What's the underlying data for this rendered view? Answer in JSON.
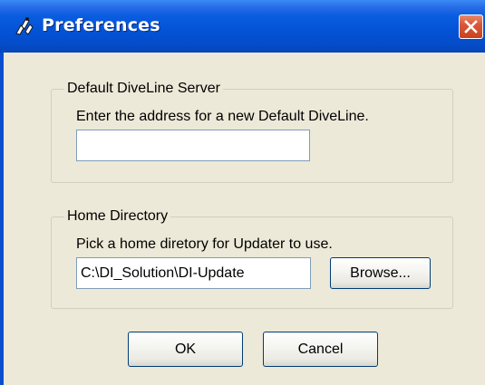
{
  "window": {
    "title": "Preferences",
    "title_icon": "diveline-app-icon",
    "close_icon": "close-icon"
  },
  "server_group": {
    "label": "Default DiveLine Server",
    "description": "Enter the address for a new Default DiveLine.",
    "address_value": ""
  },
  "home_group": {
    "label": "Home Directory",
    "description": "Pick a home diretory for Updater to use.",
    "path_value": "C:\\DI_Solution\\DI-Update",
    "browse_label": "Browse..."
  },
  "buttons": {
    "ok_label": "OK",
    "cancel_label": "Cancel"
  },
  "colors": {
    "titlebar": "#0352d6",
    "dialog_bg": "#ece9d8",
    "close_button": "#d9583a"
  }
}
